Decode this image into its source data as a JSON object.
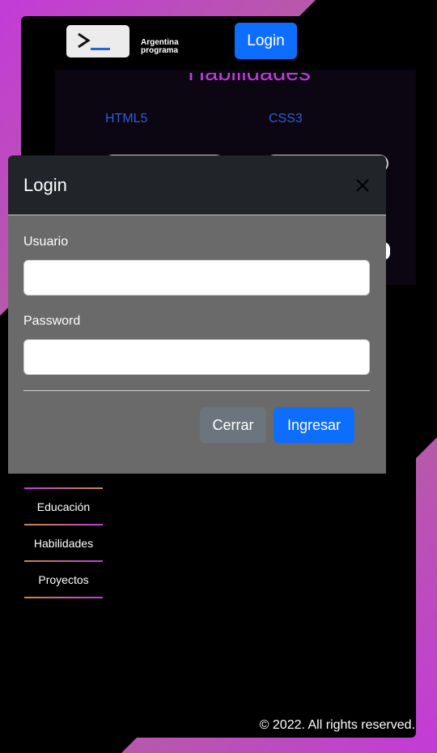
{
  "nav": {
    "brand_line1": "Argentina",
    "brand_line2": "programa",
    "login_label": "Login"
  },
  "skills": {
    "title": "Habilidades",
    "items": [
      {
        "label": "HTML5"
      },
      {
        "label": "CSS3"
      }
    ]
  },
  "sidebar": {
    "items": [
      {
        "label": "Educación"
      },
      {
        "label": "Habilidades"
      },
      {
        "label": "Proyectos"
      }
    ]
  },
  "footer": {
    "text": "© 2022. All rights reserved."
  },
  "modal": {
    "title": "Login",
    "usuario_label": "Usuario",
    "usuario_value": "",
    "password_label": "Password",
    "password_value": "",
    "close_label": "Cerrar",
    "submit_label": "Ingresar"
  },
  "colors": {
    "accent_blue": "#0d6efd",
    "skill_title": "#c13ddb",
    "skill_label": "#2c5fdc",
    "gradient_purple": "#c33bd8",
    "gradient_gold": "#c5894a"
  }
}
